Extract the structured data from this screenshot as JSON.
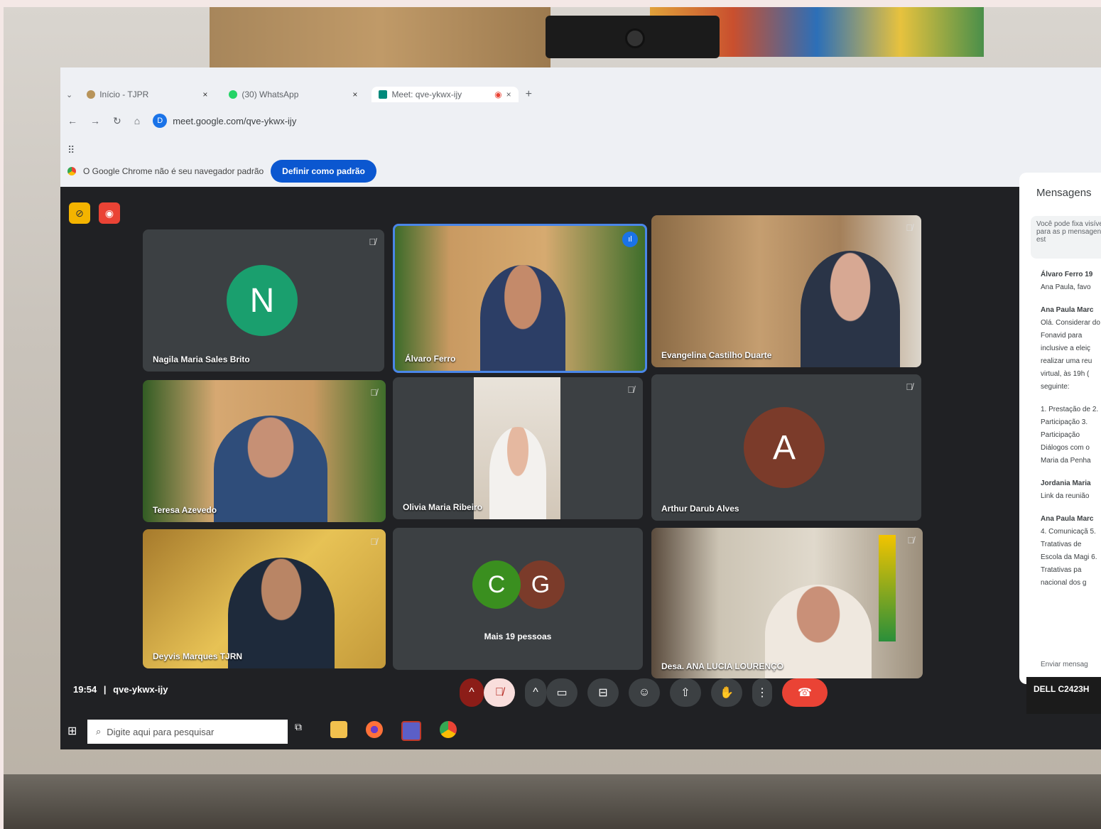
{
  "browser": {
    "tabs": [
      {
        "label": "Início - TJPR",
        "close": "×"
      },
      {
        "label": "(30) WhatsApp",
        "close": "×"
      },
      {
        "label": "Meet: qve-ykwx-ijy",
        "close": "×"
      }
    ],
    "new_tab": "+",
    "url": "meet.google.com/qve-ykwx-ijy",
    "infobar_text": "O Google Chrome não é seu navegador padrão",
    "infobar_button": "Definir como padrão"
  },
  "meeting": {
    "time": "19:54",
    "separator": "|",
    "code": "qve-ykwx-ijy",
    "participants": [
      {
        "name": "Nagila Maria Sales Brito",
        "avatar_letter": "N",
        "avatar_color": "#1a9f6e"
      },
      {
        "name": "Álvaro Ferro"
      },
      {
        "name": "Evangelina Castilho Duarte"
      },
      {
        "name": "Teresa Azevedo"
      },
      {
        "name": "Olivia Maria Ribeiro"
      },
      {
        "name": "Arthur Darub Alves",
        "avatar_letter": "A",
        "avatar_color": "#7b3b2a"
      },
      {
        "name": "Deyvis Marques TJRN"
      },
      {
        "name": "Desa. ANA LUCIA LOURENÇO"
      }
    ],
    "more": {
      "letters": [
        "C",
        "G"
      ],
      "label": "Mais 19 pessoas",
      "colors": [
        "#3a8f1f",
        "#7b3b2a"
      ]
    }
  },
  "chat_panel": {
    "title": "Mensagens",
    "pinned_text": "Você pode fixa visível para as p mensagens est",
    "messages": [
      {
        "author": "Álvaro Ferro  19",
        "text": "Ana Paula, favo"
      },
      {
        "author": "Ana Paula Marc",
        "text": "Olá. Considerar do Fonavid para inclusive a eleiç realizar uma reu virtual, às 19h ( seguinte:"
      },
      {
        "author": "",
        "text": "1. Prestação de 2. Participação 3. Participação Diálogos com o Maria da Penha"
      },
      {
        "author": "Jordania Maria",
        "text": "Link da reunião"
      },
      {
        "author": "Ana Paula Marc",
        "text": "4. Comunicaçã 5. Tratativas de Escola da Magi 6. Tratativas pa nacional dos g"
      }
    ],
    "send_placeholder": "Enviar mensag"
  },
  "monitor_label": "DELL C2423H",
  "taskbar": {
    "search_placeholder": "Digite aqui para pesquisar"
  }
}
